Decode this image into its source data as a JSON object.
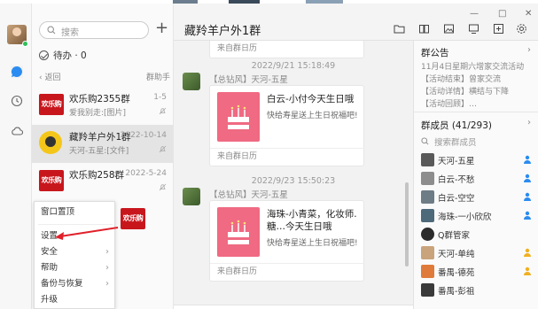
{
  "list": {
    "search_placeholder": "搜索",
    "todo": "待办 · 0",
    "back": "返回",
    "help": "群助手",
    "rows": [
      {
        "logo_text": "欢乐购",
        "name": "欢乐购2355群",
        "snippet": "爱我别走:[图片]",
        "date": "1-5"
      },
      {
        "name": "藏羚羊户外1群",
        "snippet": "天河-五星:[文件]",
        "date": "2022-10-14"
      },
      {
        "logo_text": "欢乐购",
        "name": "欢乐购258群",
        "snippet": "",
        "date": "2022-5-24"
      },
      {
        "logo_text": "欢乐购",
        "name": "",
        "snippet": "",
        "date": ""
      }
    ]
  },
  "menu": {
    "items": [
      {
        "label": "窗口置顶",
        "arrow": ""
      },
      {
        "label": "设置",
        "arrow": ""
      },
      {
        "label": "安全",
        "arrow": "›"
      },
      {
        "label": "帮助",
        "arrow": "›"
      },
      {
        "label": "备份与恢复",
        "arrow": "›"
      },
      {
        "label": "升级",
        "arrow": ""
      }
    ]
  },
  "header": {
    "title": "藏羚羊户外1群",
    "icons": [
      "folder-icon",
      "book-icon",
      "image-icon",
      "screen-icon",
      "add-member-icon",
      "gear-icon"
    ],
    "window_controls": [
      "—",
      "□",
      "✕"
    ]
  },
  "chat": {
    "messages": [
      {
        "time": "2022/9/21 15:18:49",
        "sender": "【总钻风】天河-五星",
        "card_title": "白云-小付今天生日哦",
        "card_desc": "快给寿星送上生日祝福吧!",
        "card_footer": "来自群日历"
      },
      {
        "time": "2022/9/23 15:50:23",
        "sender": "【总钻风】天河-五星",
        "card_title": "海珠-小青菜，化妆师.糖…今天生日哦",
        "card_desc": "快给寿星送上生日祝福吧!",
        "card_footer": "来自群日历"
      }
    ],
    "top_partial_footer": "来自群日历"
  },
  "right": {
    "notice_title": "群公告",
    "notices": [
      "11月4日星期六增家交流活动",
      "【活动结束】曾家交流",
      "【活动详情】横结与下降",
      "【活动回顾】…"
    ],
    "members_title": "群成员 (41/293)",
    "member_search": "搜索群成员",
    "members": [
      {
        "name": "天河-五星",
        "badge": "admin-blue"
      },
      {
        "name": "白云-不愁",
        "badge": "admin-blue"
      },
      {
        "name": "白云-空空",
        "badge": "admin-blue"
      },
      {
        "name": "海珠-一小欣欣",
        "badge": "admin-blue"
      },
      {
        "name": "Q群管家",
        "badge": ""
      },
      {
        "name": "天河-单纯",
        "badge": "admin-yellow"
      },
      {
        "name": "番禺-德苑",
        "badge": "admin-yellow"
      },
      {
        "name": "番禺-彭祖",
        "badge": ""
      }
    ]
  },
  "colors": {
    "accent": "#2a8cf0",
    "annotation_red": "#e0202a",
    "cake_pink": "#ef6a82",
    "brand_red": "#c8161d"
  }
}
